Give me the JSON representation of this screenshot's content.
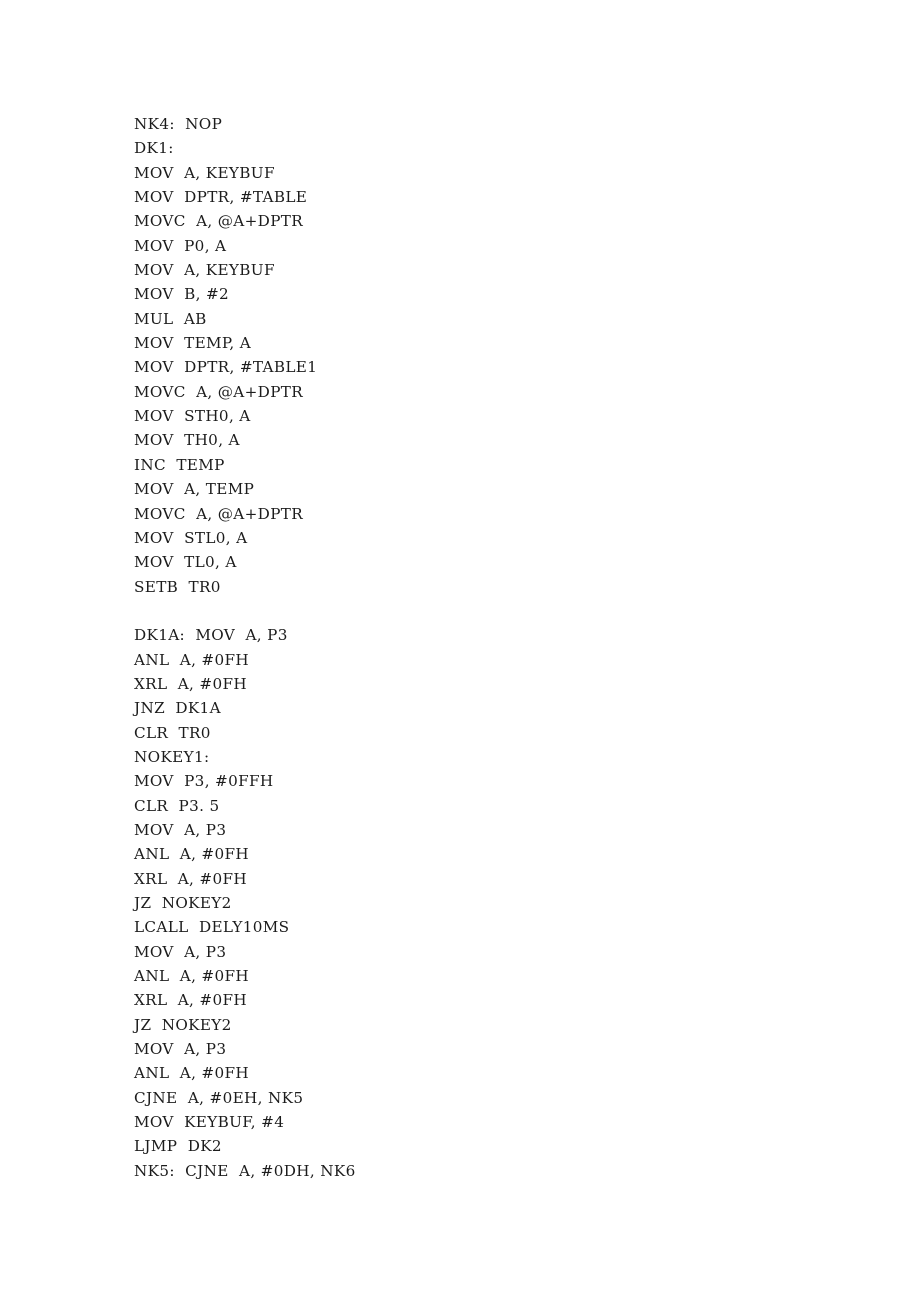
{
  "document": {
    "page_background": "#ffffff",
    "text_color": "#1c1c1c",
    "content_type": "8051 assembly source code listing",
    "lines": [
      {
        "text": "NK4:  NOP"
      },
      {
        "text": "DK1:"
      },
      {
        "text": "MOV  A, KEYBUF"
      },
      {
        "text": "MOV  DPTR, #TABLE"
      },
      {
        "text": "MOVC  A, @A+DPTR"
      },
      {
        "text": "MOV  P0, A"
      },
      {
        "text": "MOV  A, KEYBUF"
      },
      {
        "text": "MOV  B, #2"
      },
      {
        "text": "MUL  AB"
      },
      {
        "text": "MOV  TEMP, A"
      },
      {
        "text": "MOV  DPTR, #TABLE1"
      },
      {
        "text": "MOVC  A, @A+DPTR"
      },
      {
        "text": "MOV  STH0, A"
      },
      {
        "text": "MOV  TH0, A"
      },
      {
        "text": "INC  TEMP"
      },
      {
        "text": "MOV  A, TEMP"
      },
      {
        "text": "MOVC  A, @A+DPTR"
      },
      {
        "text": "MOV  STL0, A"
      },
      {
        "text": "MOV  TL0, A"
      },
      {
        "text": "SETB  TR0"
      },
      {
        "text": ""
      },
      {
        "text": "DK1A:  MOV  A, P3"
      },
      {
        "text": "ANL  A, #0FH"
      },
      {
        "text": "XRL  A, #0FH"
      },
      {
        "text": "JNZ  DK1A"
      },
      {
        "text": "CLR  TR0"
      },
      {
        "text": "NOKEY1:"
      },
      {
        "text": "MOV  P3, #0FFH"
      },
      {
        "text": "CLR  P3. 5"
      },
      {
        "text": "MOV  A, P3"
      },
      {
        "text": "ANL  A, #0FH"
      },
      {
        "text": "XRL  A, #0FH"
      },
      {
        "text": "JZ  NOKEY2"
      },
      {
        "text": "LCALL  DELY10MS"
      },
      {
        "text": "MOV  A, P3"
      },
      {
        "text": "ANL  A, #0FH"
      },
      {
        "text": "XRL  A, #0FH"
      },
      {
        "text": "JZ  NOKEY2"
      },
      {
        "text": "MOV  A, P3"
      },
      {
        "text": "ANL  A, #0FH"
      },
      {
        "text": "CJNE  A, #0EH, NK5"
      },
      {
        "text": "MOV  KEYBUF, #4"
      },
      {
        "text": "LJMP  DK2"
      },
      {
        "text": "NK5:  CJNE  A, #0DH, NK6"
      }
    ]
  }
}
